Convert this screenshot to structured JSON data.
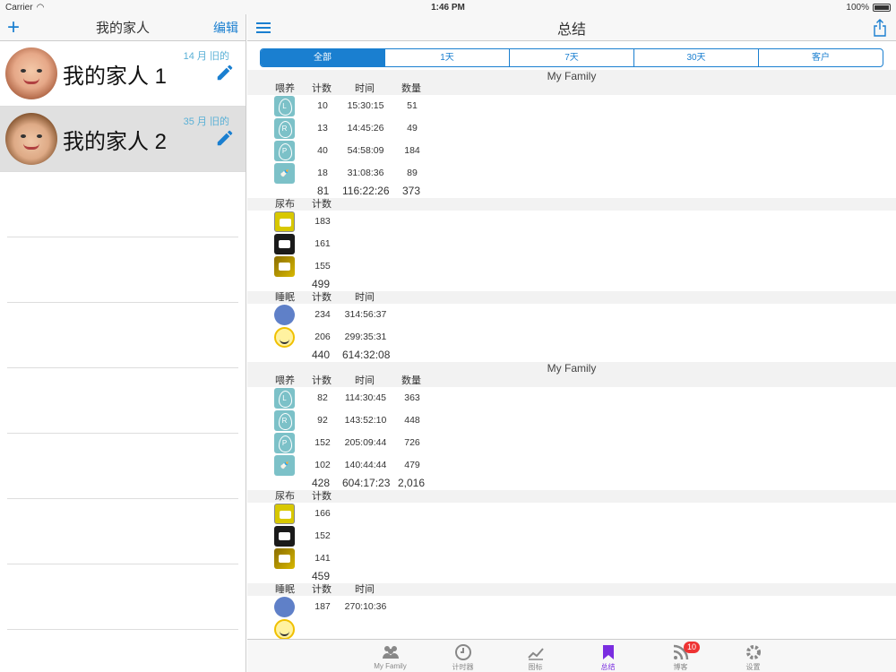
{
  "status": {
    "carrier": "Carrier",
    "time": "1:46 PM",
    "battery": "100%"
  },
  "left": {
    "title": "我的家人",
    "add_label": "+",
    "edit_label": "编辑",
    "families": [
      {
        "name": "我的家人 1",
        "age": "14 月 旧的"
      },
      {
        "name": "我的家人 2",
        "age": "35 月 旧的"
      }
    ]
  },
  "right": {
    "title": "总结",
    "segments": [
      "全部",
      "1天",
      "7天",
      "30天",
      "客户"
    ],
    "groups": [
      {
        "family": "My Family",
        "feed": {
          "headers": [
            "喂养",
            "计数",
            "时间",
            "数量"
          ],
          "rows": [
            {
              "icon": "feed-left-icon",
              "label": "L",
              "count": "10",
              "time": "15:30:15",
              "amount": "51"
            },
            {
              "icon": "feed-right-icon",
              "label": "R",
              "count": "13",
              "time": "14:45:26",
              "amount": "49"
            },
            {
              "icon": "feed-pump-icon",
              "label": "P",
              "count": "40",
              "time": "54:58:09",
              "amount": "184"
            },
            {
              "icon": "bottle-icon",
              "label": "",
              "count": "18",
              "time": "31:08:36",
              "amount": "89"
            }
          ],
          "total": {
            "count": "81",
            "time": "116:22:26",
            "amount": "373"
          }
        },
        "diaper": {
          "headers": [
            "尿布",
            "计数"
          ],
          "rows": [
            {
              "count": "183"
            },
            {
              "count": "161"
            },
            {
              "count": "155"
            }
          ],
          "total": "499"
        },
        "sleep": {
          "headers": [
            "睡眠",
            "计数",
            "时间"
          ],
          "rows": [
            {
              "count": "234",
              "time": "314:56:37"
            },
            {
              "count": "206",
              "time": "299:35:31"
            }
          ],
          "total": {
            "count": "440",
            "time": "614:32:08"
          }
        }
      },
      {
        "family": "My Family",
        "feed": {
          "headers": [
            "喂养",
            "计数",
            "时间",
            "数量"
          ],
          "rows": [
            {
              "icon": "feed-left-icon",
              "label": "L",
              "count": "82",
              "time": "114:30:45",
              "amount": "363"
            },
            {
              "icon": "feed-right-icon",
              "label": "R",
              "count": "92",
              "time": "143:52:10",
              "amount": "448"
            },
            {
              "icon": "feed-pump-icon",
              "label": "P",
              "count": "152",
              "time": "205:09:44",
              "amount": "726"
            },
            {
              "icon": "bottle-icon",
              "label": "",
              "count": "102",
              "time": "140:44:44",
              "amount": "479"
            }
          ],
          "total": {
            "count": "428",
            "time": "604:17:23",
            "amount": "2,016"
          }
        },
        "diaper": {
          "headers": [
            "尿布",
            "计数"
          ],
          "rows": [
            {
              "count": "166"
            },
            {
              "count": "152"
            },
            {
              "count": "141"
            }
          ],
          "total": "459"
        },
        "sleep": {
          "headers": [
            "睡眠",
            "计数",
            "时间"
          ],
          "rows": [
            {
              "count": "187",
              "time": "270:10:36"
            }
          ]
        }
      }
    ]
  },
  "tabs": [
    {
      "label": "My Family",
      "icon": "family-icon"
    },
    {
      "label": "计时器",
      "icon": "clock-icon"
    },
    {
      "label": "图标",
      "icon": "chart-icon"
    },
    {
      "label": "总结",
      "icon": "bookmark-icon",
      "active": true
    },
    {
      "label": "博客",
      "icon": "rss-icon",
      "badge": "10"
    },
    {
      "label": "设置",
      "icon": "gear-icon"
    }
  ],
  "colors": {
    "accent": "#1a7fd0",
    "active_tab": "#7a2de0",
    "badge": "#ee3333"
  }
}
